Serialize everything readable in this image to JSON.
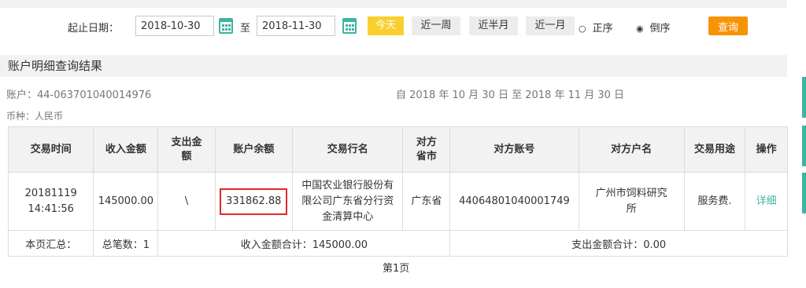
{
  "filter": {
    "date_label": "起止日期：",
    "start_date": "2018-10-30",
    "to_label": "至",
    "end_date": "2018-11-30",
    "quick_buttons": [
      "今天",
      "近一周",
      "近半月",
      "近一月"
    ],
    "order_options": [
      "正序",
      "倒序"
    ],
    "selected_order": "倒序",
    "search_label": "查询"
  },
  "result": {
    "section_title": "账户明细查询结果",
    "account": "账户：44-063701040014976",
    "date_range": "自 2018 年 10 月 30 日 至 2018 年 11 月 30 日",
    "currency": "币种：人民币",
    "columns": [
      "交易时间",
      "收入金额",
      "支出金额",
      "账户余额",
      "交易行名",
      "对方省市",
      "对方账号",
      "对方户名",
      "交易用途",
      "操作"
    ],
    "rows": [
      {
        "time_date": "20181119",
        "time_clock": "14:41:56",
        "income": "145000.00",
        "expense": "\\",
        "balance": "331862.88",
        "bank_name": "中国农业银行股份有限公司广东省分行资金清算中心",
        "province": "广东省",
        "counter_account": "44064801040001749",
        "counter_name": "广州市饲料研究所",
        "purpose": "服务费.",
        "action": "详细"
      }
    ],
    "summary": {
      "label": "本页汇总：",
      "count": "总笔数：1",
      "income_total": "收入金额合计：145000.00",
      "expense_total": "支出金额合计：0.00"
    },
    "page": "第1页"
  },
  "colors": {
    "accent": "#3bb5a0",
    "search": "#f79406",
    "today": "#f9cf2f",
    "highlight": "#e0282e"
  }
}
